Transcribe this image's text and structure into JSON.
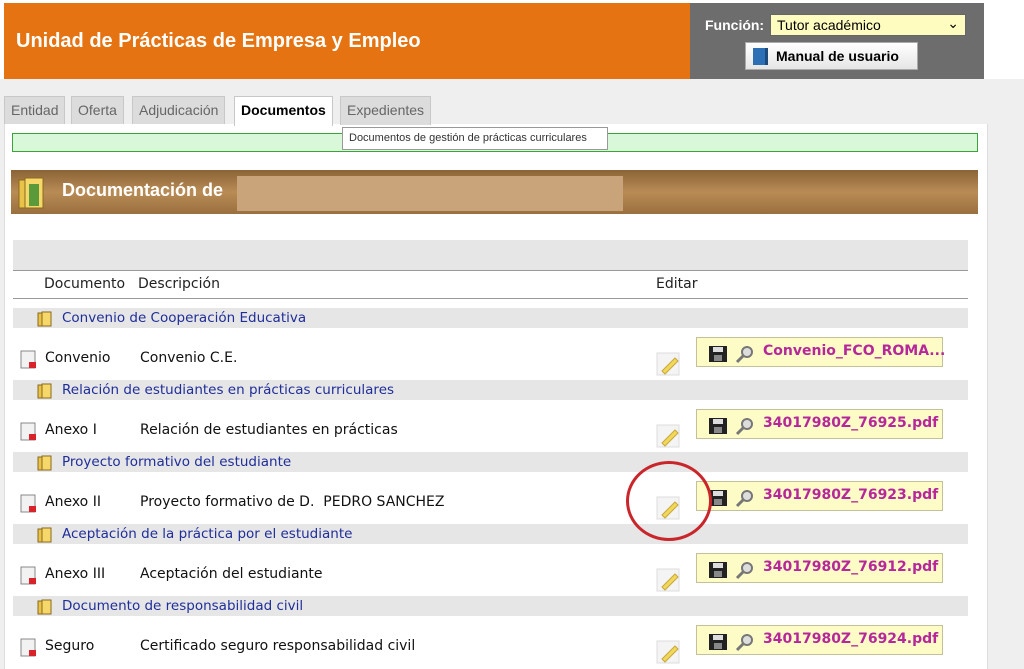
{
  "header": {
    "title": "Unidad de Prácticas de Empresa y Empleo",
    "function_label": "Función:",
    "function_value": "Tutor académico",
    "manual_button": "Manual de usuario"
  },
  "tabs": [
    {
      "label": "Entidad"
    },
    {
      "label": "Oferta"
    },
    {
      "label": "Adjudicación"
    },
    {
      "label": "Documentos"
    },
    {
      "label": "Expedientes"
    }
  ],
  "tooltip": "Documentos de gestión de prácticas curriculares",
  "doc_header": {
    "title": "Documentación de"
  },
  "columns": {
    "document": "Documento",
    "description": "Descripción",
    "edit": "Editar"
  },
  "sections": [
    {
      "title": "Convenio de Cooperación Educativa",
      "row": {
        "document": "Convenio",
        "description": "Convenio C.E.",
        "file": "Convenio_FCO_ROMA..."
      }
    },
    {
      "title": "Relación de estudiantes en prácticas curriculares",
      "row": {
        "document": "Anexo I",
        "description": "Relación de estudiantes en prácticas",
        "file": "34017980Z_76925.pdf"
      }
    },
    {
      "title": "Proyecto formativo del estudiante",
      "row": {
        "document": "Anexo II",
        "description": "Proyecto formativo de D.  PEDRO SANCHEZ",
        "file": "34017980Z_76923.pdf"
      }
    },
    {
      "title": "Aceptación de la práctica por el estudiante",
      "row": {
        "document": "Anexo III",
        "description": "Aceptación del estudiante",
        "file": "34017980Z_76912.pdf"
      }
    },
    {
      "title": "Documento de responsabilidad civil",
      "row": {
        "document": "Seguro",
        "description": "Certificado seguro responsabilidad civil",
        "file": "34017980Z_76924.pdf"
      }
    }
  ],
  "colors": {
    "header_orange": "#e67312",
    "section_text": "#1f2e9a",
    "file_link": "#b5279a",
    "highlight_circle": "#c9262b"
  }
}
